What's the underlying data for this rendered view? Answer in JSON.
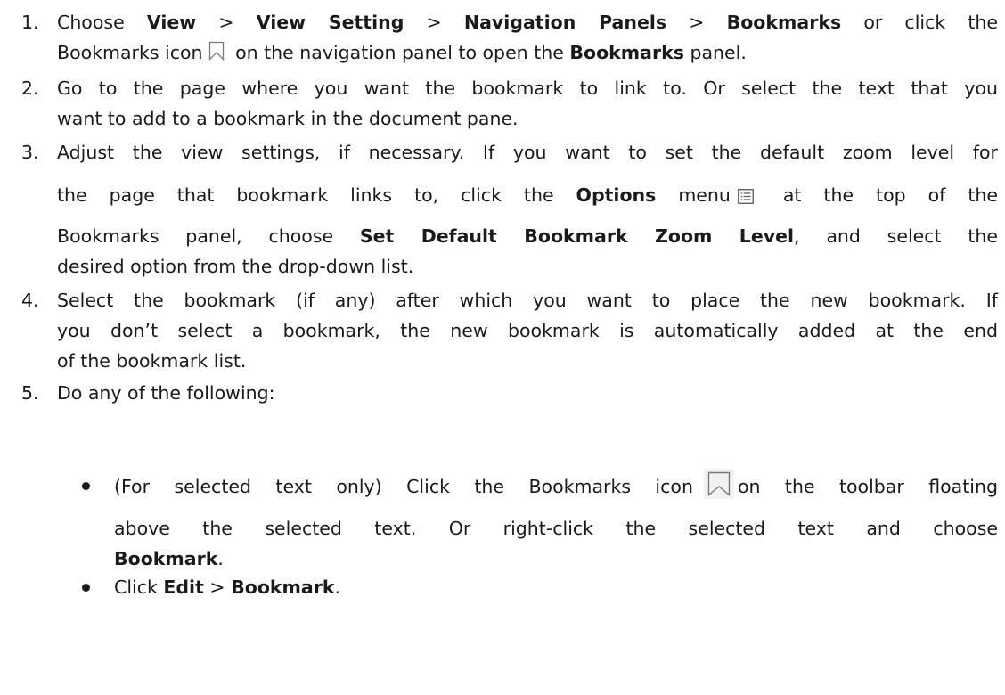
{
  "steps": [
    {
      "number": "1.",
      "lines": {
        "l1": {
          "a": "Choose ",
          "b1": "View",
          "s1": " > ",
          "b2": "View Setting",
          "s2": " > ",
          "b3": "Navigation Panels",
          "s3": " > ",
          "b4": "Bookmarks",
          "s4": " or click the"
        },
        "l2": {
          "a": "Bookmarks icon",
          "b": " on the navigation panel to open the ",
          "c": "Bookmarks",
          "d": " panel."
        }
      }
    },
    {
      "number": "2.",
      "lines": {
        "l1": "Go to the page where you want the bookmark to link to. Or select the text that you",
        "l2": "want to add to a bookmark in the document pane."
      }
    },
    {
      "number": "3.",
      "lines": {
        "l1": "Adjust the view settings, if necessary. If you want to set the default zoom level for",
        "l2": {
          "a": "the page that bookmark links to, click the ",
          "b": "Options",
          "c": " menu",
          "d": " at the top of the"
        },
        "l3": {
          "a": "Bookmarks panel, choose ",
          "b": "Set Default Bookmark Zoom Level",
          "c": ", and select the"
        },
        "l4": "desired option from the drop-down list."
      }
    },
    {
      "number": "4.",
      "lines": {
        "l1": "Select the bookmark (if any) after which you want to place the new bookmark. If",
        "l2": "you don’t select a bookmark, the new bookmark is automatically added at the end",
        "l3": "of the bookmark list."
      }
    },
    {
      "number": "5.",
      "lines": {
        "l1": "Do any of the following:"
      }
    }
  ],
  "bullets": [
    {
      "l1": {
        "a": "(For selected text only) Click the Bookmarks icon",
        "b": "on the toolbar floating"
      },
      "l2": "above the selected text. Or right-click the selected text and choose",
      "l3": {
        "a": "Bookmark",
        "b": "."
      }
    },
    {
      "l1": {
        "a": "Click ",
        "b": "Edit",
        "c": " > ",
        "d": "Bookmark",
        "e": "."
      }
    }
  ],
  "icons": {
    "bookmark_small": "bookmark-icon",
    "options_menu": "options-menu-icon",
    "bookmark_large": "bookmark-icon"
  },
  "colors": {
    "text": "#1a1a1a",
    "icon_stroke": "#7a7a7a",
    "icon_bg": "#f2f2f2"
  }
}
